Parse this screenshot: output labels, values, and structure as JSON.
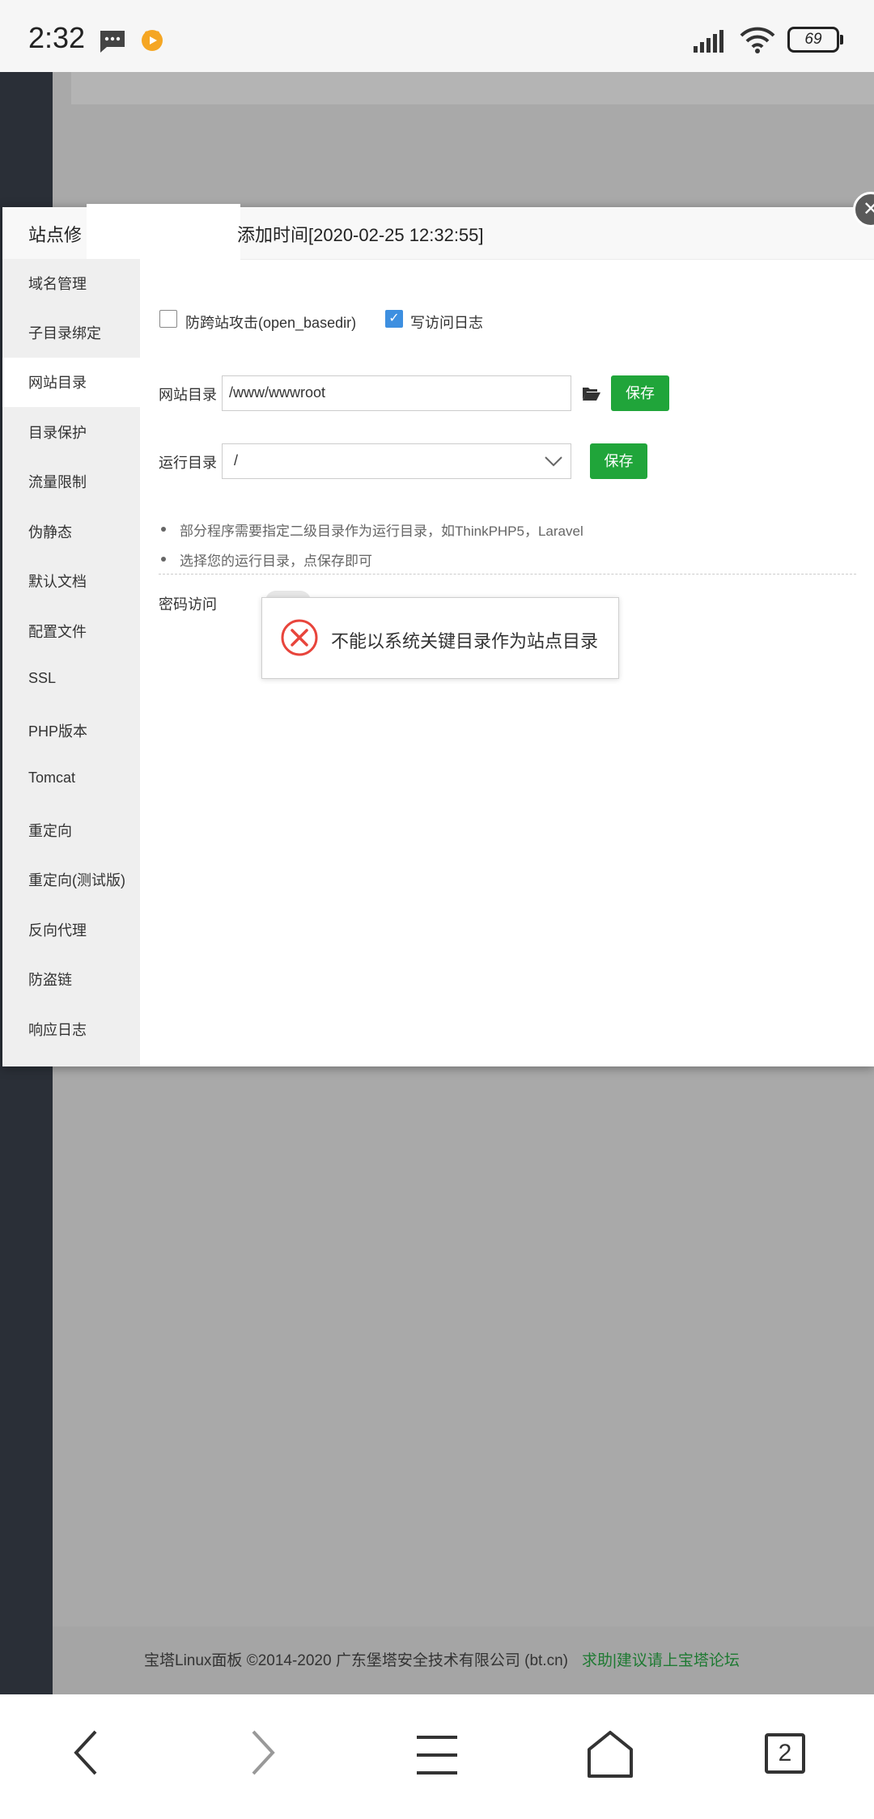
{
  "status_bar": {
    "time": "2:32",
    "battery": "69"
  },
  "modal": {
    "title": "站点修",
    "title_time": "添加时间[2020-02-25 12:32:55]",
    "close_icon": "close-icon"
  },
  "sidebar": {
    "items": [
      {
        "label": "域名管理"
      },
      {
        "label": "子目录绑定"
      },
      {
        "label": "网站目录"
      },
      {
        "label": "目录保护"
      },
      {
        "label": "流量限制"
      },
      {
        "label": "伪静态"
      },
      {
        "label": "默认文档"
      },
      {
        "label": "配置文件"
      },
      {
        "label": "SSL"
      },
      {
        "label": "PHP版本"
      },
      {
        "label": "Tomcat"
      },
      {
        "label": "重定向"
      },
      {
        "label": "重定向(测试版)"
      },
      {
        "label": "反向代理"
      },
      {
        "label": "防盗链"
      },
      {
        "label": "响应日志"
      }
    ],
    "active_index": 2
  },
  "content": {
    "checkbox_basedir_label": "防跨站攻击(open_basedir)",
    "checkbox_basedir_checked": false,
    "checkbox_log_label": "写访问日志",
    "checkbox_log_checked": true,
    "site_dir_label": "网站目录",
    "site_dir_value": "/www/wwwroot",
    "save_label": "保存",
    "run_dir_label": "运行目录",
    "run_dir_value": "/",
    "save_label_2": "保存",
    "hints": [
      "部分程序需要指定二级目录作为运行目录，如ThinkPHP5，Laravel",
      "选择您的运行目录，点保存即可"
    ],
    "password_access_label": "密码访问"
  },
  "toast": {
    "message": "不能以系统关键目录作为站点目录"
  },
  "footer": {
    "copyright": "宝塔Linux面板 ©2014-2020 广东堡塔安全技术有限公司 (bt.cn)",
    "help_link": "求助|建议请上宝塔论坛"
  },
  "navbar": {
    "tabs_count": "2"
  },
  "colors": {
    "accent_green": "#20a53a",
    "sidebar_dark": "#2a2f37",
    "error_red": "#e8453c"
  }
}
